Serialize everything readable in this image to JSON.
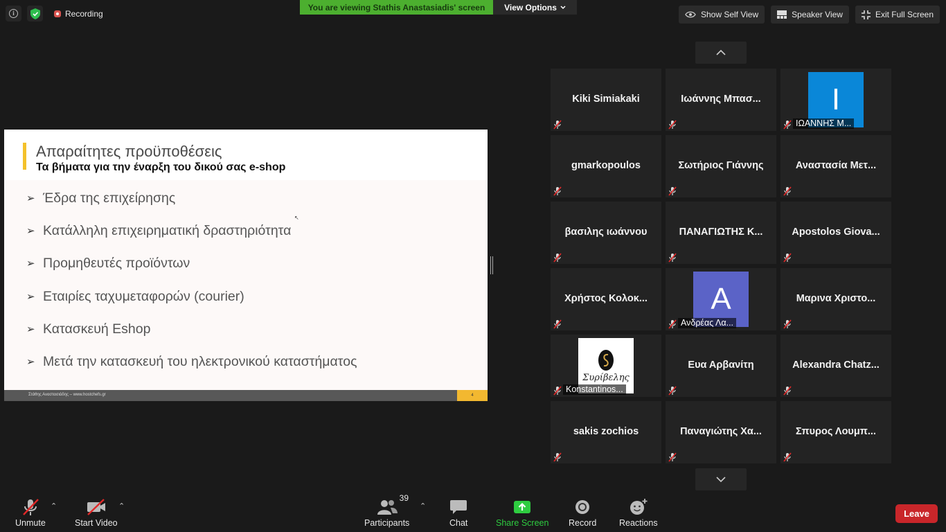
{
  "top_left": {
    "recording_label": "Recording"
  },
  "banner": {
    "viewing_text": "You are viewing Stathis Anastasiadis' screen",
    "view_options_label": "View Options"
  },
  "top_right": {
    "show_self_view": "Show Self View",
    "speaker_view": "Speaker View",
    "exit_full_screen": "Exit Full Screen"
  },
  "slide": {
    "title": "Απαραίτητες προϋποθέσεις",
    "subtitle": "Τα βήματα για την έναρξη του δικού σας e-shop",
    "bullets": [
      "Έδρα της επιχείρησης",
      "Κατάλληλη επιχειρηματική δραστηριότητα",
      "Προμηθευτές προϊόντων",
      "Εταιρίες ταχυμεταφορών (courier)",
      "Κατασκευή Eshop",
      "Μετά την κατασκευή του ηλεκτρονικού καταστήματος"
    ],
    "footer_text": "Στάθης Αναστασιάδης – www.hostchefs.gr",
    "page_number": "4"
  },
  "gallery": [
    {
      "name": "Kiki Simiakaki"
    },
    {
      "name": "Ιωάννης Μπασ..."
    },
    {
      "name": "ΙΩΑΝΝΗΣ Μ...",
      "avatar": "I",
      "avatar_color": "#0a87d8"
    },
    {
      "name": "gmarkopoulos"
    },
    {
      "name": "Σωτήριος Γιάννης"
    },
    {
      "name": "Αναστασία Μετ..."
    },
    {
      "name": "βασιλης ιωάννου"
    },
    {
      "name": "ΠΑΝΑΓΙΩΤΗΣ Κ..."
    },
    {
      "name": "Apostolos Giova..."
    },
    {
      "name": "Χρήστος Κολοκ..."
    },
    {
      "name": "Ανδρέας Λα...",
      "avatar": "A",
      "avatar_color": "#5b63c7"
    },
    {
      "name": "Μαρινα Χριστο..."
    },
    {
      "name": "Konstantinos...",
      "logo_text": "Συρίβελης"
    },
    {
      "name": "Ευα Αρβανίτη"
    },
    {
      "name": "Alexandra Chatz..."
    },
    {
      "name": "sakis zochios"
    },
    {
      "name": "Παναγιώτης Χα..."
    },
    {
      "name": "Σπυρος Λουμπ..."
    }
  ],
  "toolbar": {
    "unmute": "Unmute",
    "start_video": "Start Video",
    "participants": "Participants",
    "participants_count": "39",
    "chat": "Chat",
    "share_screen": "Share Screen",
    "record": "Record",
    "reactions": "Reactions",
    "leave": "Leave"
  },
  "colors": {
    "share_green": "#2ecc40",
    "leave_red": "#c9262a",
    "banner_green": "#4caf2f",
    "slide_accent": "#f4c12b"
  }
}
